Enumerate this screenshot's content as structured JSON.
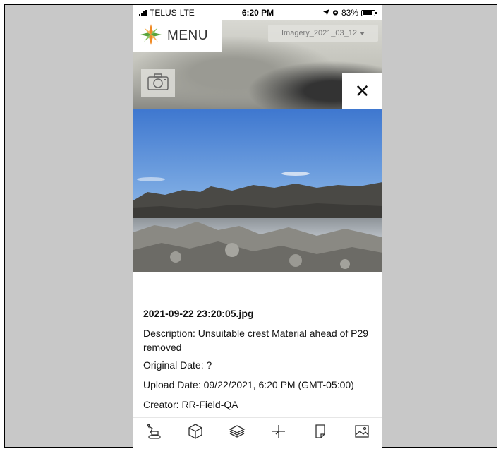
{
  "status_bar": {
    "carrier": "TELUS",
    "network": "LTE",
    "time": "6:20 PM",
    "battery_text": "83%",
    "battery_level": 0.83
  },
  "header": {
    "menu_label": "MENU",
    "imagery_select": "Imagery_2021_03_12",
    "camera_icon": "camera-icon",
    "close_symbol": "✕"
  },
  "photo": {
    "filename": "2021-09-22 23:20:05.jpg",
    "description": "Description: Unsuitable crest Material ahead of P29 removed",
    "original_date": "Original Date: ?",
    "upload_date": "Upload Date: 09/22/2021, 6:20 PM (GMT-05:00)",
    "creator": "Creator: RR-Field-QA"
  },
  "toolbar": {
    "icons": [
      "excavator-icon",
      "cube-icon",
      "layers-icon",
      "crosshair-icon",
      "note-icon",
      "image-icon"
    ]
  },
  "colors": {
    "frame_bg": "#c8c8c8",
    "logo_orange": "#f08a24",
    "logo_green": "#5aa33c"
  }
}
